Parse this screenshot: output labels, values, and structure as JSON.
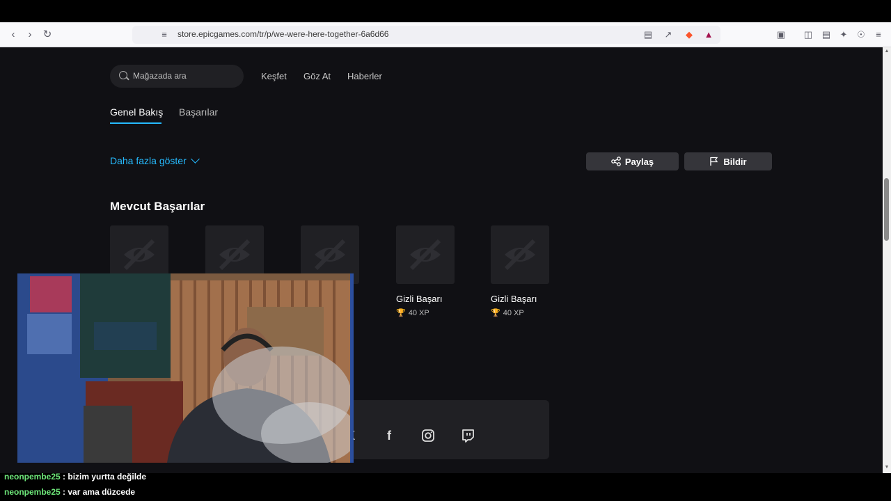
{
  "browser": {
    "url": "store.epicgames.com/tr/p/we-were-here-together-6a6d66",
    "brave_badge": "1"
  },
  "store_nav": {
    "search_placeholder": "Mağazada ara",
    "links": [
      "Keşfet",
      "Göz At",
      "Haberler"
    ]
  },
  "tabs": {
    "overview": "Genel Bakış",
    "achievements": "Başarılar"
  },
  "actions": {
    "show_more": "Daha fazla göster",
    "share": "Paylaş",
    "report": "Bildir"
  },
  "achievements_section": {
    "title": "Mevcut Başarılar",
    "items": [
      {
        "name": "",
        "xp": ""
      },
      {
        "name": "",
        "xp": ""
      },
      {
        "name": "",
        "xp": ""
      },
      {
        "name": "Gizli Başarı",
        "xp": "40 XP"
      },
      {
        "name": "Gizli Başarı",
        "xp": "40 XP"
      }
    ]
  },
  "social": [
    "x-icon",
    "facebook-icon",
    "instagram-icon",
    "twitch-icon"
  ],
  "chat": [
    {
      "user": "neonpembe25",
      "message": " : bizim yurtta değilde"
    },
    {
      "user": "neonpembe25",
      "message": " : var ama düzcede"
    }
  ],
  "colors": {
    "accent": "#26bbff",
    "page_bg": "#101014",
    "tile_bg": "#202024",
    "chat_user": "#6ee87a"
  }
}
